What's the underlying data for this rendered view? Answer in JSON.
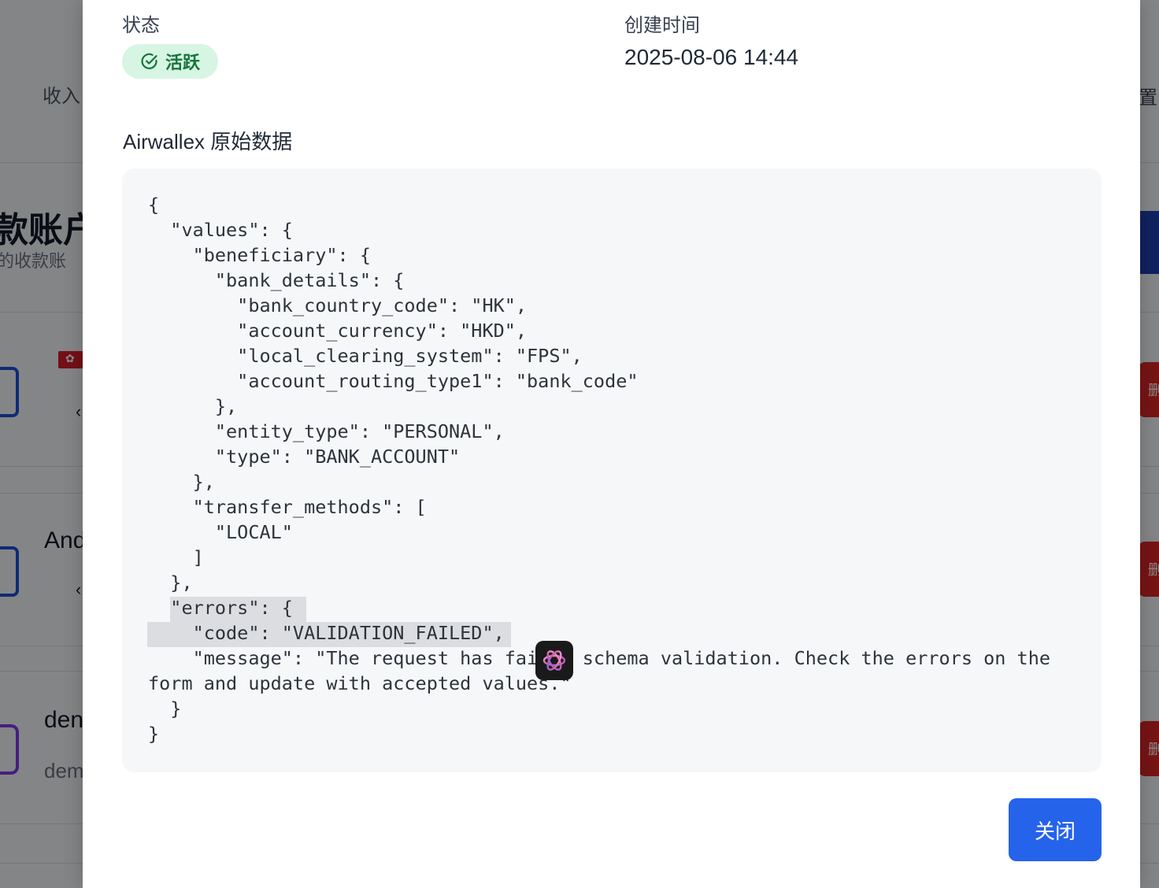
{
  "background": {
    "nav_fragment": "收入",
    "page_title_fragment": "款账户",
    "page_subtitle_fragment": "的收款账",
    "account_name_1": "And",
    "account_name_2": "den",
    "account_name_2_sub": "dem",
    "right_nav_fragment": "置",
    "delete_fragment": "删"
  },
  "modal": {
    "status_label": "状态",
    "status_value": "活跃",
    "created_label": "创建时间",
    "created_value": "2025-08-06 14:44",
    "raw_data_title": "Airwallex 原始数据",
    "code_lines": [
      "{",
      "  \"values\": {",
      "    \"beneficiary\": {",
      "      \"bank_details\": {",
      "        \"bank_country_code\": \"HK\",",
      "        \"account_currency\": \"HKD\",",
      "        \"local_clearing_system\": \"FPS\",",
      "        \"account_routing_type1\": \"bank_code\"",
      "      },",
      "      \"entity_type\": \"PERSONAL\",",
      "      \"type\": \"BANK_ACCOUNT\"",
      "    },",
      "    \"transfer_methods\": [",
      "      \"LOCAL\"",
      "    ]",
      "  },",
      "  \"errors\": {",
      "    \"code\": \"VALIDATION_FAILED\",",
      "    \"message\": \"The request has failed schema validation. Check the errors on the",
      "form and update with accepted values.\"",
      "  }",
      "}"
    ],
    "close_label": "关闭"
  },
  "colors": {
    "accent": "#2563eb",
    "status_bg": "#d7f5e3",
    "status_text": "#16753b",
    "code_bg": "#f6f7f9"
  },
  "icons": {
    "status": "check-circle-icon",
    "overlay_app": "chatgpt-icon"
  }
}
